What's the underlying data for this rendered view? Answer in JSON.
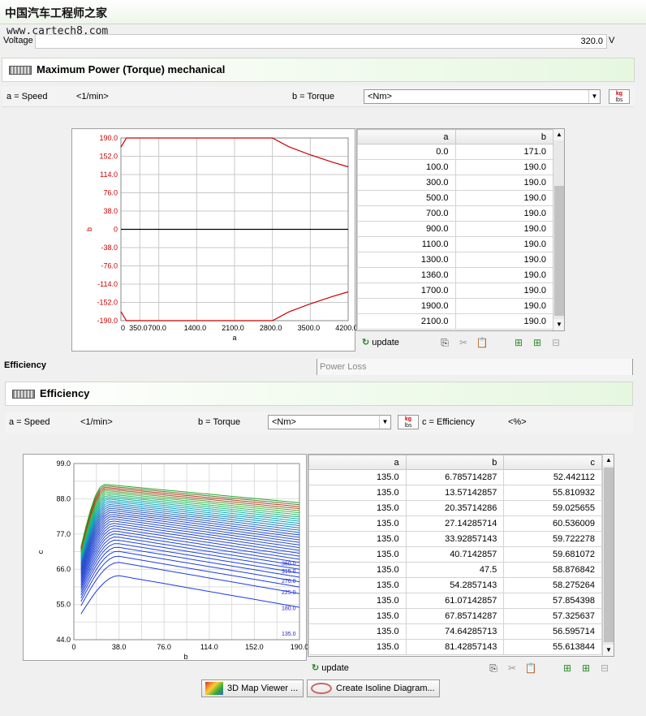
{
  "watermark": {
    "site_cn": "中国汽车工程师之家",
    "site_url": "www.cartech8.com"
  },
  "voltage": {
    "label": "Voltage",
    "value": "320.0",
    "unit": "V"
  },
  "power_section": {
    "title": "Maximum Power (Torque) mechanical",
    "a_label": "a = Speed",
    "a_unit": "<1/min>",
    "b_label": "b = Torque",
    "b_unit": "<Nm>",
    "unit_button": {
      "top": "kg",
      "bottom": "lbs"
    },
    "columns": [
      "a",
      "b"
    ],
    "rows": [
      [
        "0.0",
        "171.0"
      ],
      [
        "100.0",
        "190.0"
      ],
      [
        "300.0",
        "190.0"
      ],
      [
        "500.0",
        "190.0"
      ],
      [
        "700.0",
        "190.0"
      ],
      [
        "900.0",
        "190.0"
      ],
      [
        "1100.0",
        "190.0"
      ],
      [
        "1300.0",
        "190.0"
      ],
      [
        "1360.0",
        "190.0"
      ],
      [
        "1700.0",
        "190.0"
      ],
      [
        "1900.0",
        "190.0"
      ],
      [
        "2100.0",
        "190.0"
      ]
    ],
    "update_label": "update"
  },
  "tabs": {
    "efficiency": "Efficiency",
    "power_loss": "Power Loss"
  },
  "efficiency_section": {
    "title": "Efficiency",
    "a_label": "a = Speed",
    "a_unit": "<1/min>",
    "b_label": "b = Torque",
    "b_unit": "<Nm>",
    "c_label": "c = Efficiency",
    "c_unit": "<%>",
    "unit_button": {
      "top": "kg",
      "bottom": "lbs"
    },
    "columns": [
      "a",
      "b",
      "c"
    ],
    "rows": [
      [
        "135.0",
        "6.785714287",
        "52.442112"
      ],
      [
        "135.0",
        "13.57142857",
        "55.810932"
      ],
      [
        "135.0",
        "20.35714286",
        "59.025655"
      ],
      [
        "135.0",
        "27.14285714",
        "60.536009"
      ],
      [
        "135.0",
        "33.92857143",
        "59.722278"
      ],
      [
        "135.0",
        "40.7142857",
        "59.681072"
      ],
      [
        "135.0",
        "47.5",
        "58.876842"
      ],
      [
        "135.0",
        "54.2857143",
        "58.275264"
      ],
      [
        "135.0",
        "61.07142857",
        "57.854398"
      ],
      [
        "135.0",
        "67.85714287",
        "57.325637"
      ],
      [
        "135.0",
        "74.64285713",
        "56.595714"
      ],
      [
        "135.0",
        "81.42857143",
        "55.613844"
      ]
    ],
    "update_label": "update",
    "map_viewer_label": "3D Map Viewer ...",
    "isoline_label": "Create Isoline Diagram..."
  },
  "chart_data": [
    {
      "type": "line",
      "xlabel": "a",
      "ylabel": "b",
      "xticks": [
        "0",
        "350.0",
        "700.0",
        "1400.0",
        "2100.0",
        "2800.0",
        "3500.0",
        "4200.0"
      ],
      "yticks": [
        "190.0",
        "152.0",
        "114.0",
        "76.0",
        "38.0",
        "0",
        "-38.0",
        "-76.0",
        "-114.0",
        "-152.0",
        "-190.0"
      ],
      "xlim": [
        0,
        4200
      ],
      "ylim": [
        -190,
        190
      ],
      "series": [
        {
          "x": [
            0,
            100,
            300,
            700,
            1400,
            2100,
            2800,
            3100,
            3500,
            3900,
            4200
          ],
          "y": [
            171,
            190,
            190,
            190,
            190,
            190,
            190,
            172,
            155,
            140,
            130
          ]
        },
        {
          "x": [
            0,
            100,
            300,
            700,
            1400,
            2100,
            2800,
            3100,
            3500,
            3900,
            4200
          ],
          "y": [
            -171,
            -190,
            -190,
            -190,
            -190,
            -190,
            -190,
            -172,
            -155,
            -140,
            -130
          ]
        }
      ],
      "color": "#cc0000",
      "grid": true
    },
    {
      "type": "line",
      "xlabel": "b",
      "ylabel": "c",
      "xticks": [
        "0",
        "38.0",
        "76.0",
        "114.0",
        "152.0",
        "190.0"
      ],
      "yticks": [
        "99.0",
        "88.0",
        "77.0",
        "66.0",
        "55.0",
        "44.0"
      ],
      "xlim": [
        0,
        190
      ],
      "ylim": [
        44,
        99
      ],
      "contour_labels": [
        "135.0",
        "180.0",
        "225.0",
        "270.0",
        "315.0",
        "360.0"
      ],
      "grid": true
    }
  ]
}
